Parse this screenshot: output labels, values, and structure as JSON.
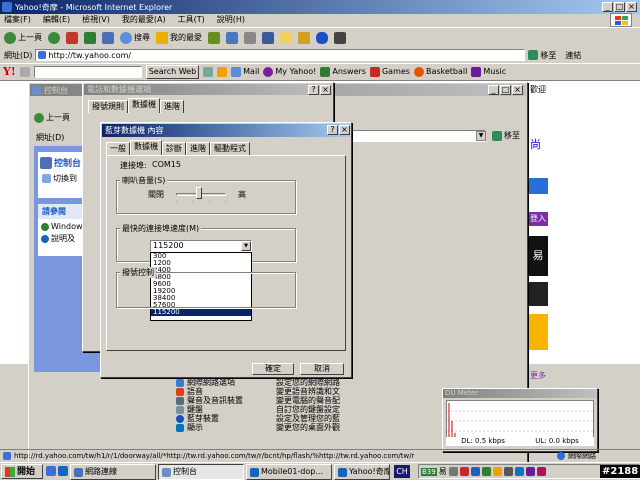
{
  "ie": {
    "title": "Yahoo!奇摩 - Microsoft Internet Explorer",
    "menu": [
      "檔案(F)",
      "編輯(E)",
      "檢視(V)",
      "我的最愛(A)",
      "工具(T)",
      "說明(H)"
    ],
    "toolbar": {
      "back": "上一頁",
      "search": "搜尋",
      "favorites": "我的最愛"
    },
    "address_label": "網址(D)",
    "address_value": "http://tw.yahoo.com/",
    "go_label": "移至",
    "links_label": "連結",
    "status_url": "http://rd.yahoo.com/tw/h1/r/1/doorway/all/*http://tw.rd.yahoo.com/tw/r/bcnt/hp/flash/%http://tw.rd.yahoo.com/tw/r",
    "status_zone": "網際網路"
  },
  "yahoo_toolbar": {
    "search_web": "Search Web",
    "items": [
      "Mail",
      "My Yahoo!",
      "Answers",
      "Games",
      "Basketball",
      "Music"
    ]
  },
  "page_right": {
    "text1": "歡迎",
    "text2": "尚",
    "text3": "易",
    "text4": "更多",
    "text5": "登入"
  },
  "control_panel": {
    "title": "控制台",
    "back": "上一頁",
    "address_label": "網址(D)",
    "go_label": "移至",
    "header": "控制台",
    "switch_view": "切換到",
    "see_also": "請參閱",
    "see_also_items": [
      "Windows",
      "說明及"
    ],
    "items": [
      {
        "name": "網際網路選項",
        "desc": "設定您的網際網路"
      },
      {
        "name": "語音",
        "desc": "變更語音辨識和文"
      },
      {
        "name": "聲音及音訊裝置",
        "desc": "變更電腦的聲音配"
      },
      {
        "name": "鍵盤",
        "desc": "自訂您的鍵盤設定"
      },
      {
        "name": "藍芽裝置",
        "desc": "設定及管理您的藍"
      },
      {
        "name": "顯示",
        "desc": "變更您的桌面外觀"
      }
    ]
  },
  "phone_modem": {
    "title": "電話和數據機選項",
    "tabs": [
      "撥號規則",
      "數據機",
      "進階"
    ]
  },
  "dialog": {
    "title": "藍芽數據機 內容",
    "help": "?",
    "close": "×",
    "tabs": [
      "一般",
      "數據機",
      "診斷",
      "進階",
      "驅動程式"
    ],
    "port_label": "連接埠:",
    "port_value": "COM15",
    "volume_label": "喇叭音量(S)",
    "vol_off": "關閉",
    "vol_high": "高",
    "volume_level": 0.45,
    "speed_label": "最快的連接埠速度(M)",
    "speed_selected": "115200",
    "speed_options": [
      "300",
      "1200",
      "2400",
      "4800",
      "9600",
      "19200",
      "38400",
      "57600",
      "115200"
    ],
    "dial_label": "撥號控制",
    "ok": "確定",
    "cancel": "取消"
  },
  "du_meter": {
    "title": "DU Meter",
    "dl": "DL: 0.5 kbps",
    "ul": "UL: 0.0 kbps"
  },
  "taskbar": {
    "start": "開始",
    "tasks": [
      "網路連線",
      "控制台",
      "Mobile01-dop...",
      "Yahoo!奇摩 -"
    ],
    "lang": "CH",
    "tray_badge": "B39",
    "tray_text": "易"
  },
  "watermark": "#2188"
}
